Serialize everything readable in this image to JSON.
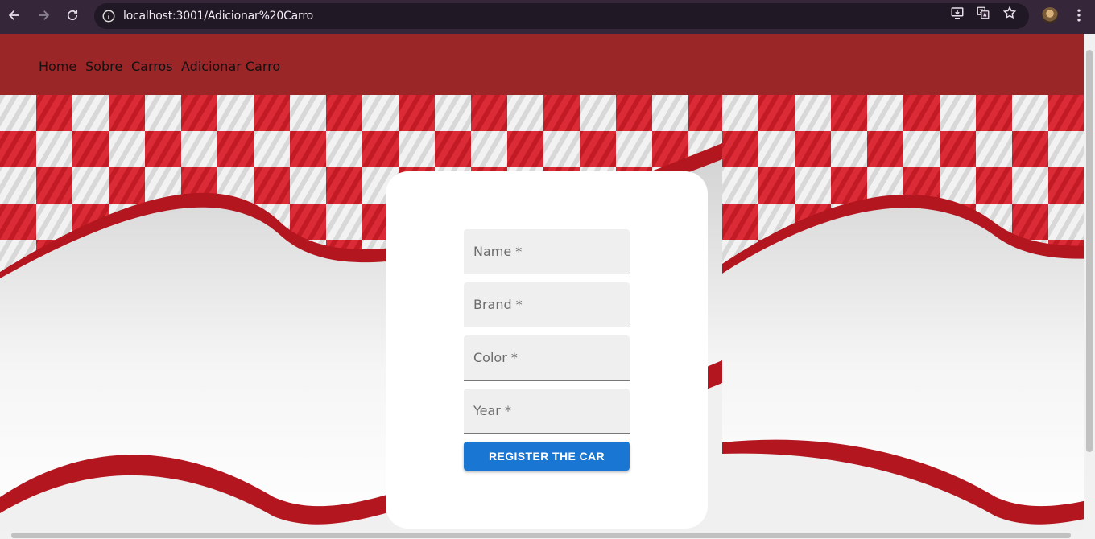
{
  "browser": {
    "url": "localhost:3001/Adicionar%20Carro"
  },
  "navbar": {
    "links": [
      {
        "label": "Home"
      },
      {
        "label": "Sobre"
      },
      {
        "label": "Carros"
      },
      {
        "label": "Adicionar Carro"
      }
    ]
  },
  "form": {
    "fields": [
      {
        "placeholder": "Name *"
      },
      {
        "placeholder": "Brand *"
      },
      {
        "placeholder": "Color *"
      },
      {
        "placeholder": "Year *"
      }
    ],
    "submit_label": "REGISTER THE CAR"
  },
  "colors": {
    "navbar": "#9a2628",
    "accent": "#1976d2",
    "checker_red": "#d91e2a"
  }
}
